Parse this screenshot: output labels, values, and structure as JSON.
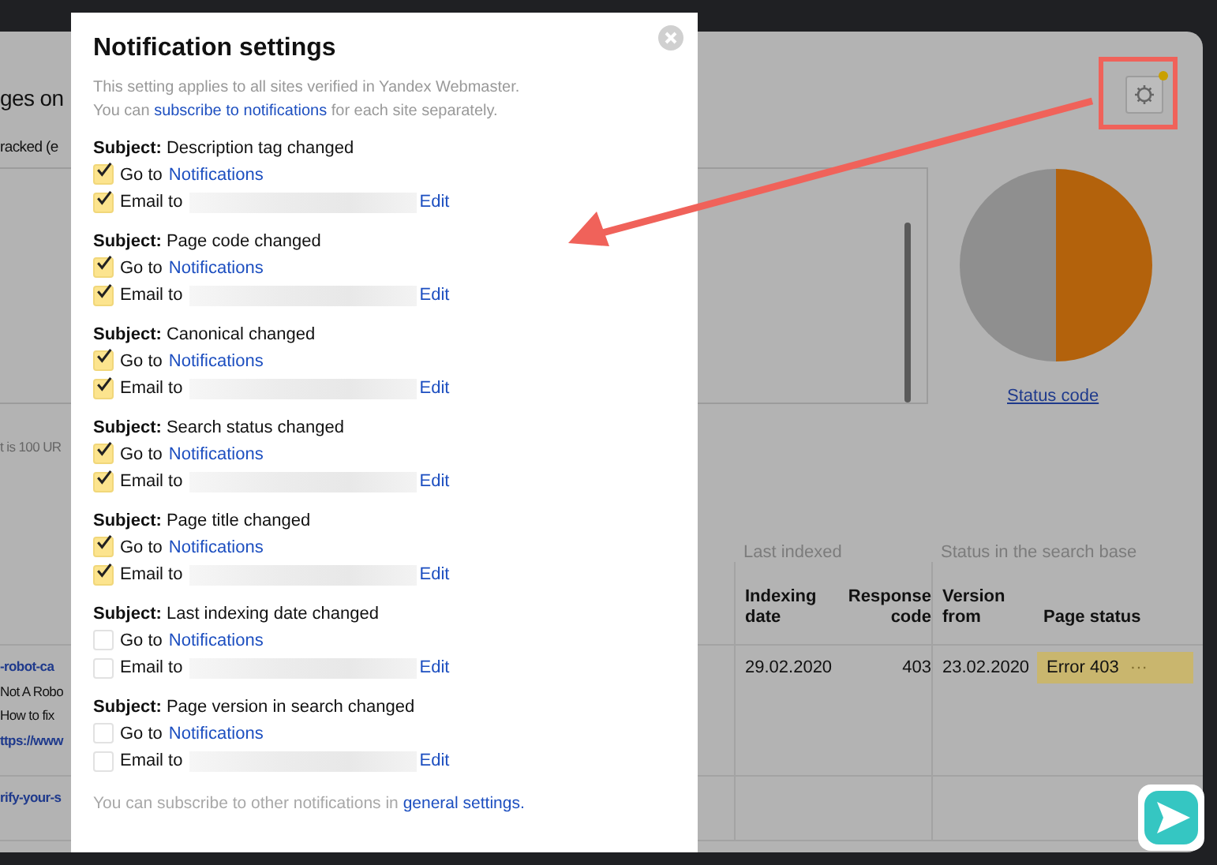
{
  "page": {
    "heading": "ges on",
    "subheading": "racked (e",
    "note": "t is 100 UR",
    "settings_button": {
      "has_notification": true
    },
    "chart_link": "Status code",
    "table": {
      "group_headers": [
        "Last indexed",
        "Status in the search base"
      ],
      "columns": [
        "Indexing date",
        "Response code",
        "Version from",
        "Page status"
      ],
      "rows": [
        {
          "url_lines": [
            "-robot-ca",
            "Not A Robo",
            "How to fix",
            "ttps://www"
          ],
          "indexing_date": "29.02.2020",
          "response_code": "403",
          "version_from": "23.02.2020",
          "page_status": "Error 403",
          "status_menu": "···"
        },
        {
          "url_lines": [
            "rify-your-s"
          ],
          "indexing_date": "",
          "response_code": "",
          "version_from": "",
          "page_status": "",
          "status_menu": ""
        }
      ]
    }
  },
  "dialog": {
    "title": "Notification settings",
    "intro_line": "This setting applies to all sites verified in Yandex Webmaster.",
    "intro_before": "You can ",
    "intro_link": "subscribe to notifications",
    "intro_after": " for each site separately.",
    "groups": [
      {
        "subject": "**Subject:** Description tag changed",
        "goto": {
          "text": "Go to",
          "link": "Notifications",
          "checked": true
        },
        "email": {
          "text": "Email to",
          "link": "Edit",
          "checked": true
        }
      },
      {
        "subject": "**Subject:** Page code changed",
        "goto": {
          "text": "Go to",
          "link": "Notifications",
          "checked": true
        },
        "email": {
          "text": "Email to",
          "link": "Edit",
          "checked": true
        }
      },
      {
        "subject": "**Subject:** Canonical changed",
        "goto": {
          "text": "Go to",
          "link": "Notifications",
          "checked": true
        },
        "email": {
          "text": "Email to",
          "link": "Edit",
          "checked": true
        }
      },
      {
        "subject": "**Subject:** Search status changed",
        "goto": {
          "text": "Go to",
          "link": "Notifications",
          "checked": true
        },
        "email": {
          "text": "Email to",
          "link": "Edit",
          "checked": true
        }
      },
      {
        "subject": "**Subject:** Page title changed",
        "goto": {
          "text": "Go to",
          "link": "Notifications",
          "checked": true
        },
        "email": {
          "text": "Email to",
          "link": "Edit",
          "checked": true
        }
      },
      {
        "subject": "**Subject:** Last indexing date changed",
        "goto": {
          "text": "Go to",
          "link": "Notifications",
          "checked": false
        },
        "email": {
          "text": "Email to",
          "link": "Edit",
          "checked": false
        }
      },
      {
        "subject": "**Subject:** Page version in search changed",
        "goto": {
          "text": "Go to",
          "link": "Notifications",
          "checked": false
        },
        "email": {
          "text": "Email to",
          "link": "Edit",
          "checked": false
        }
      }
    ],
    "footer_before": "You can subscribe to other notifications in ",
    "footer_link": "general settings."
  }
}
